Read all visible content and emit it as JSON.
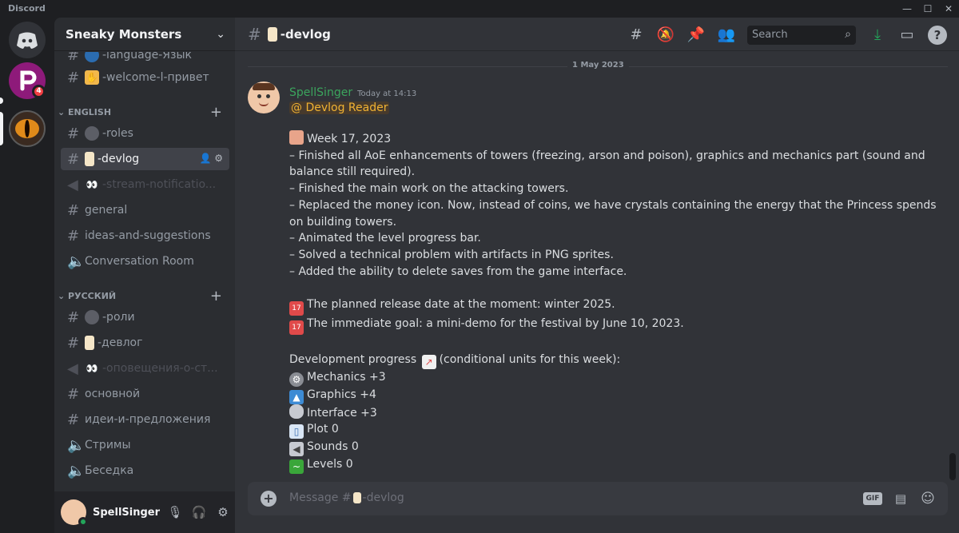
{
  "window": {
    "app_name": "Discord"
  },
  "servers": {
    "badge_count": "4"
  },
  "guild": {
    "name": "Sneaky Monsters"
  },
  "channels": {
    "top_partial_1": "-language-Язык",
    "top_partial_2": "-welcome-l-привет",
    "cat_english": "ENGLISH",
    "en": [
      {
        "label": "-roles"
      },
      {
        "label": "-devlog"
      },
      {
        "label": "-stream-notificatio..."
      },
      {
        "label": "general"
      },
      {
        "label": "ideas-and-suggestions"
      },
      {
        "label": "Conversation Room"
      }
    ],
    "cat_russian": "РУССКИЙ",
    "ru": [
      {
        "label": "-роли"
      },
      {
        "label": "-девлог"
      },
      {
        "label": "-оповещения-о-ст..."
      },
      {
        "label": "основной"
      },
      {
        "label": "идеи-и-предложения"
      },
      {
        "label": "Стримы"
      },
      {
        "label": "Беседка"
      }
    ]
  },
  "user": {
    "name": "SpellSinger"
  },
  "header": {
    "channel": "-devlog",
    "search_placeholder": "Search"
  },
  "chat": {
    "date_divider": "1 May 2023",
    "message": {
      "author": "SpellSinger",
      "timestamp": "Today at 14:13",
      "mention": "@ Devlog Reader",
      "lines": [
        "Week 17, 2023",
        "– Finished all AoE enhancements of towers (freezing, arson and poison), graphics and mechanics part (sound and balance still required).",
        "– Finished the main work on the attacking towers.",
        "– Replaced the money icon. Now, instead of coins, we have crystals containing the energy that the Princess spends on building towers.",
        "– Animated the level progress bar.",
        "– Solved a technical problem with artifacts in PNG sprites.",
        "– Added the ability to delete saves from the game interface.",
        "The planned release date at the moment: winter 2025.",
        "The immediate goal: a mini-demo for the festival by June 10, 2023.",
        "Development progress",
        "(conditional units for this week):",
        "Mechanics  +3",
        "Graphics  +4",
        "Interface  +3",
        "Plot  0",
        "Sounds  0",
        "Levels  0"
      ]
    }
  },
  "composer": {
    "placeholder": "Message #",
    "placeholder_channel": "-devlog",
    "gif_label": "GIF"
  }
}
